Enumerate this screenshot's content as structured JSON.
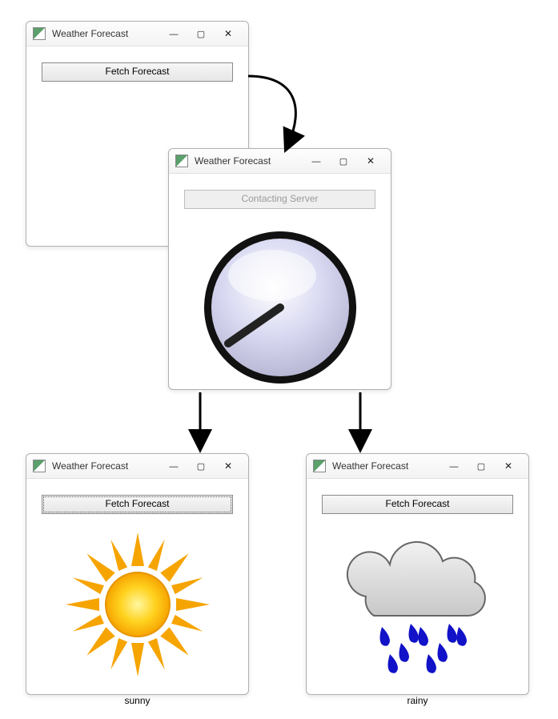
{
  "windows": {
    "initial": {
      "title": "Weather Forecast",
      "button": "Fetch Forecast"
    },
    "loading": {
      "title": "Weather Forecast",
      "button": "Contacting Server"
    },
    "sunny": {
      "title": "Weather Forecast",
      "button": "Fetch Forecast",
      "status": "sunny"
    },
    "rainy": {
      "title": "Weather Forecast",
      "button": "Fetch Forecast",
      "status": "rainy"
    }
  },
  "icons": {
    "minimize": "minimize-icon",
    "maximize": "maximize-icon",
    "close": "close-icon",
    "app": "app-icon",
    "dial": "loading-dial-icon",
    "sun": "sun-icon",
    "raincloud": "raincloud-icon"
  }
}
